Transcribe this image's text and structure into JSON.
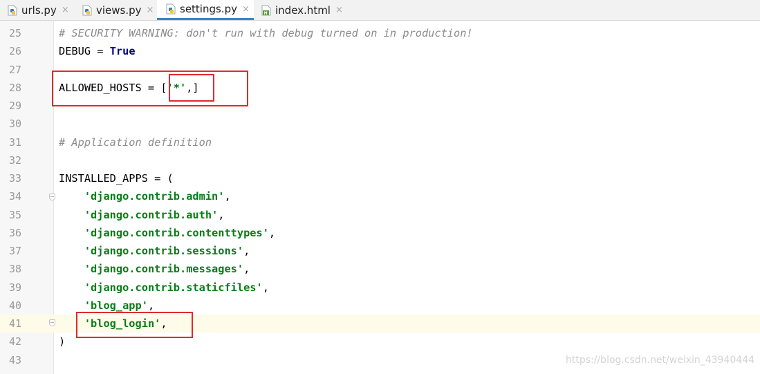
{
  "tabs": [
    {
      "label": "urls.py",
      "icon": "python-file-icon"
    },
    {
      "label": "views.py",
      "icon": "python-file-icon"
    },
    {
      "label": "settings.py",
      "icon": "python-file-icon",
      "active": true
    },
    {
      "label": "index.html",
      "icon": "html-file-icon"
    }
  ],
  "close_glyph": "×",
  "lines": [
    {
      "n": "25",
      "segments": [
        {
          "t": "# SECURITY WARNING: don't run with debug turned on in production!",
          "c": "cm"
        }
      ]
    },
    {
      "n": "26",
      "segments": [
        {
          "t": "DEBUG = ",
          "c": ""
        },
        {
          "t": "True",
          "c": "kw"
        }
      ]
    },
    {
      "n": "27",
      "segments": []
    },
    {
      "n": "28",
      "segments": [
        {
          "t": "ALLOWED_HOSTS = [",
          "c": ""
        },
        {
          "t": "'*'",
          "c": "str"
        },
        {
          "t": ",]",
          "c": ""
        }
      ]
    },
    {
      "n": "29",
      "segments": []
    },
    {
      "n": "30",
      "segments": []
    },
    {
      "n": "31",
      "segments": [
        {
          "t": "# Application definition",
          "c": "cm"
        }
      ]
    },
    {
      "n": "32",
      "segments": []
    },
    {
      "n": "33",
      "segments": [
        {
          "t": "INSTALLED_APPS = (",
          "c": ""
        }
      ]
    },
    {
      "n": "34",
      "segments": [
        {
          "t": "    ",
          "c": ""
        },
        {
          "t": "'django.contrib.admin'",
          "c": "str"
        },
        {
          "t": ",",
          "c": ""
        }
      ]
    },
    {
      "n": "35",
      "segments": [
        {
          "t": "    ",
          "c": ""
        },
        {
          "t": "'django.contrib.auth'",
          "c": "str"
        },
        {
          "t": ",",
          "c": ""
        }
      ]
    },
    {
      "n": "36",
      "segments": [
        {
          "t": "    ",
          "c": ""
        },
        {
          "t": "'django.contrib.contenttypes'",
          "c": "str"
        },
        {
          "t": ",",
          "c": ""
        }
      ]
    },
    {
      "n": "37",
      "segments": [
        {
          "t": "    ",
          "c": ""
        },
        {
          "t": "'django.contrib.sessions'",
          "c": "str"
        },
        {
          "t": ",",
          "c": ""
        }
      ]
    },
    {
      "n": "38",
      "segments": [
        {
          "t": "    ",
          "c": ""
        },
        {
          "t": "'django.contrib.messages'",
          "c": "str"
        },
        {
          "t": ",",
          "c": ""
        }
      ]
    },
    {
      "n": "39",
      "segments": [
        {
          "t": "    ",
          "c": ""
        },
        {
          "t": "'django.contrib.staticfiles'",
          "c": "str"
        },
        {
          "t": ",",
          "c": ""
        }
      ]
    },
    {
      "n": "40",
      "segments": [
        {
          "t": "    ",
          "c": ""
        },
        {
          "t": "'blog_app'",
          "c": "str"
        },
        {
          "t": ",",
          "c": ""
        }
      ]
    },
    {
      "n": "41",
      "segments": [
        {
          "t": "    ",
          "c": ""
        },
        {
          "t": "'blog_login'",
          "c": "str"
        },
        {
          "t": ",",
          "c": ""
        }
      ],
      "current": true
    },
    {
      "n": "42",
      "segments": [
        {
          "t": ")",
          "c": ""
        }
      ]
    },
    {
      "n": "43",
      "segments": []
    }
  ],
  "watermark": "https://blog.csdn.net/weixin_43940444",
  "colors": {
    "comment": "#8c8c8c",
    "keyword": "#000080",
    "string": "#067d17",
    "highlight_box": "#e02a2a",
    "current_line": "#fefce8",
    "active_tab_underline": "#4083c9"
  }
}
